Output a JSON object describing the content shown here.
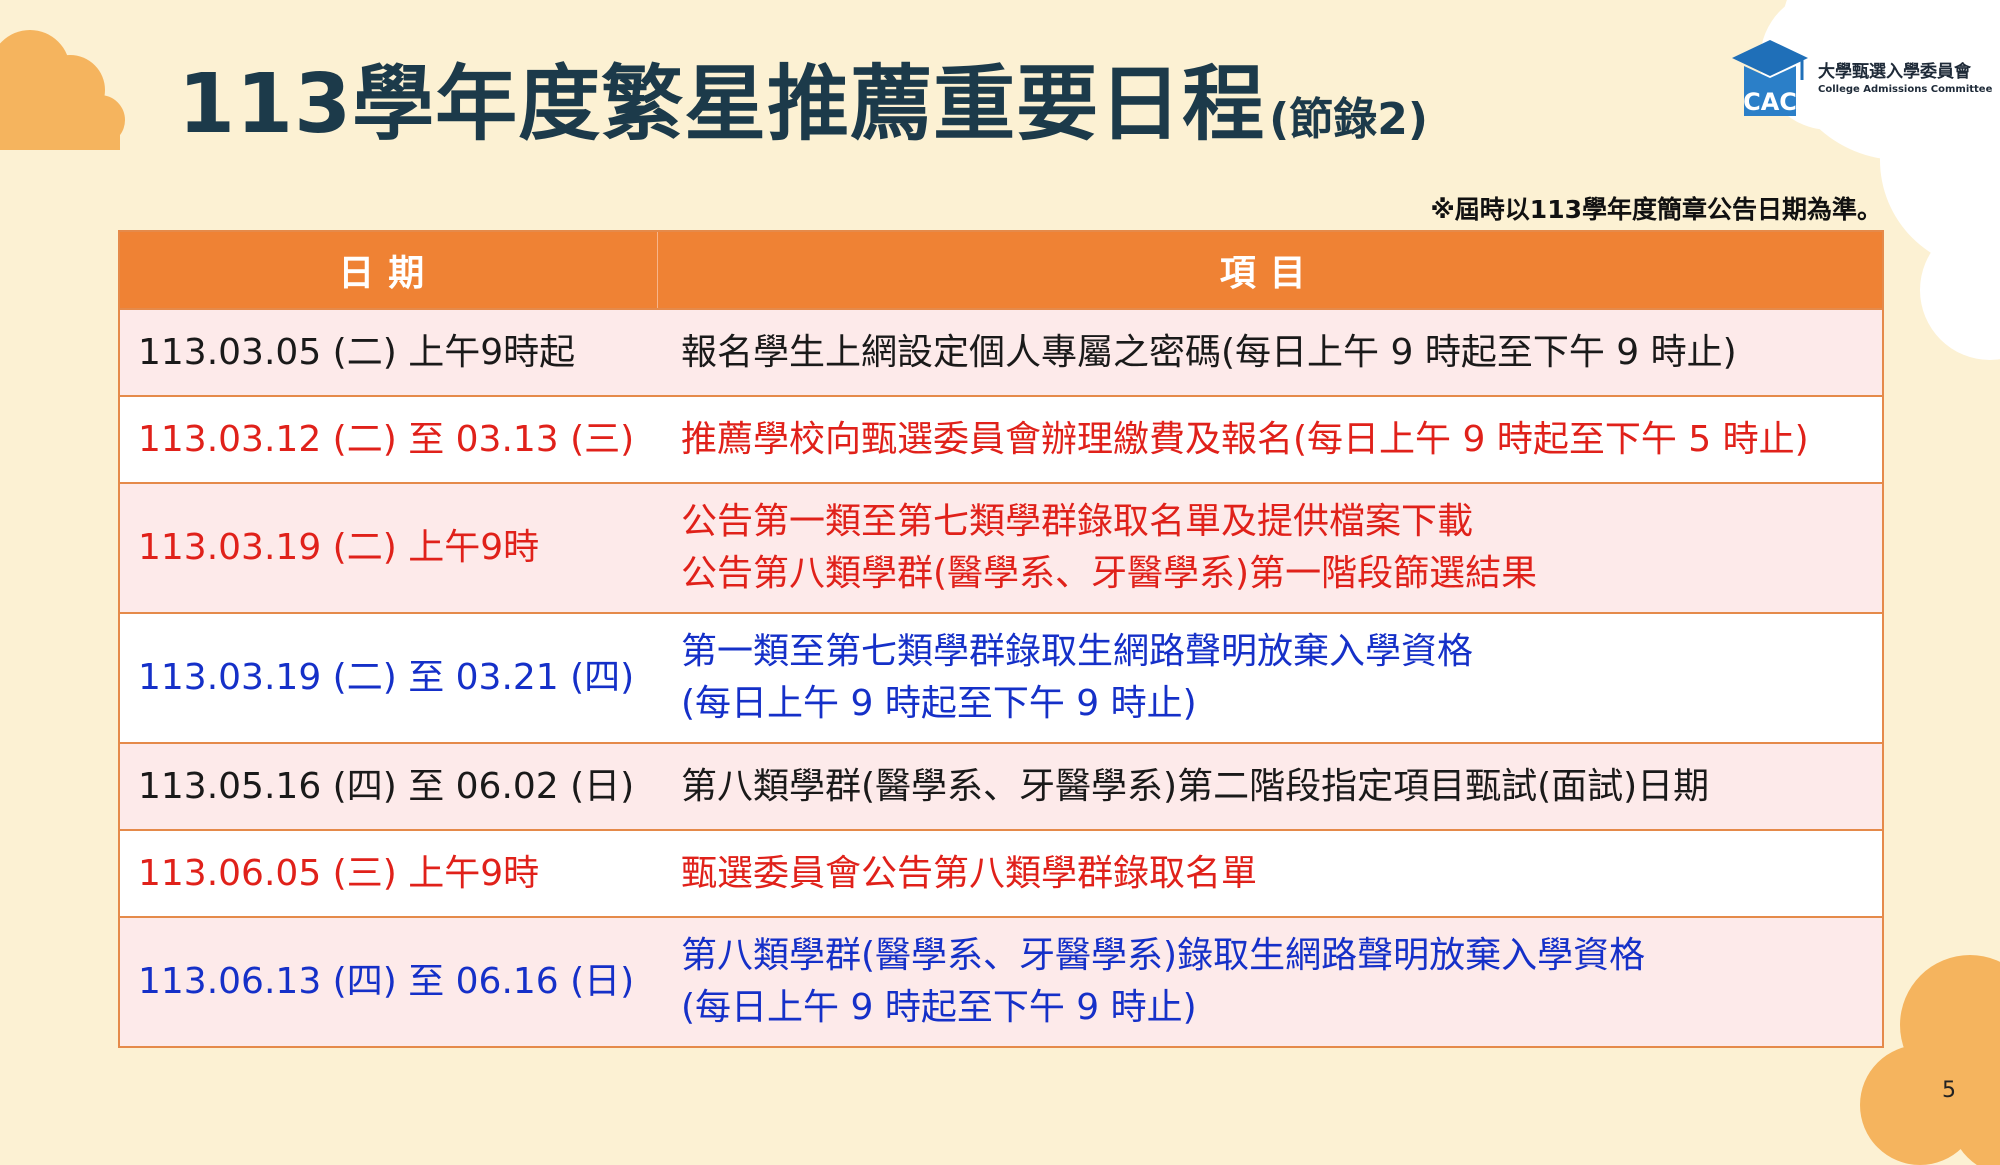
{
  "title": {
    "main": "113學年度繁星推薦重要日程",
    "sub": "(節錄2)"
  },
  "logo": {
    "name_cn": "大學甄選入學委員會",
    "name_en": "College Admissions Committee",
    "mark_text": "CAC"
  },
  "note": "※屆時以113學年度簡章公告日期為準。",
  "table": {
    "headers": [
      "日期",
      "項目"
    ],
    "rows": [
      {
        "date": "113.03.05 (二) 上午9時起",
        "lines": [
          "報名學生上網設定個人專屬之密碼(每日上午 9 時起至下午 9 時止)"
        ],
        "color": "#1a1a1a"
      },
      {
        "date": "113.03.12 (二) 至 03.13 (三)",
        "lines": [
          "推薦學校向甄選委員會辦理繳費及報名(每日上午 9 時起至下午 5 時止)"
        ],
        "color": "#e0211a"
      },
      {
        "date": "113.03.19 (二) 上午9時",
        "lines": [
          "公告第一類至第七類學群錄取名單及提供檔案下載",
          "公告第八類學群(醫學系、牙醫學系)第一階段篩選結果"
        ],
        "color": "#e0211a"
      },
      {
        "date": "113.03.19 (二) 至 03.21 (四)",
        "lines": [
          "第一類至第七類學群錄取生網路聲明放棄入學資格",
          "(每日上午 9 時起至下午 9 時止)"
        ],
        "color": "#1530c8"
      },
      {
        "date": "113.05.16 (四) 至 06.02 (日)",
        "lines": [
          "第八類學群(醫學系、牙醫學系)第二階段指定項目甄試(面試)日期"
        ],
        "color": "#1a1a1a"
      },
      {
        "date": "113.06.05 (三) 上午9時",
        "lines": [
          "甄選委員會公告第八類學群錄取名單"
        ],
        "color": "#e0211a"
      },
      {
        "date": "113.06.13 (四) 至 06.16 (日)",
        "lines": [
          "第八類學群(醫學系、牙醫學系)錄取生網路聲明放棄入學資格",
          "(每日上午 9 時起至下午 9 時止)"
        ],
        "color": "#1530c8"
      }
    ]
  },
  "page_number": "5",
  "colors": {
    "background": "#fcf1d3",
    "header_orange": "#ef8234",
    "row_pink": "#fdeaea",
    "title_navy": "#1c3a4a",
    "cloud_orange": "#f5b45e"
  }
}
